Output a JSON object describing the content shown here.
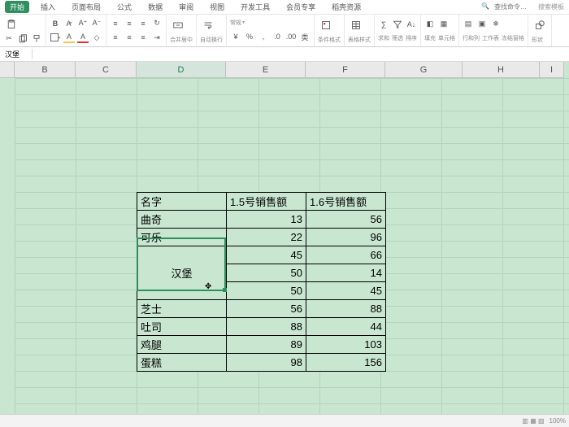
{
  "menus": {
    "items": [
      "开始",
      "插入",
      "页面布局",
      "公式",
      "数据",
      "审阅",
      "视图",
      "开发工具",
      "会员专享",
      "稻壳资源"
    ],
    "active": 0,
    "search_placeholder": "查找命令…",
    "search_hint": "搜索模板"
  },
  "ribbon": {
    "paste": "粘贴",
    "align_label": "合并居中",
    "wrap_label": "自动换行",
    "general": "常规",
    "cond_fmt": "条件格式",
    "table_style": "表格样式",
    "sum": "求和",
    "filter": "筛选",
    "sort": "排序",
    "fill": "填充",
    "cell": "单元格",
    "row_col": "行和列",
    "worksheet": "工作表",
    "freeze": "冻结窗格",
    "shapes": "形状"
  },
  "namebox": "汉堡",
  "columns": [
    "B",
    "C",
    "D",
    "E",
    "F",
    "G",
    "H",
    "I"
  ],
  "table": {
    "headers": [
      "名字",
      "1.5号销售额",
      "1.6号销售额"
    ],
    "rows": [
      {
        "name": "曲奇",
        "v1": 13,
        "v2": 56
      },
      {
        "name": "可乐",
        "v1": 22,
        "v2": 96
      },
      {
        "name": "汉堡",
        "span": 3,
        "cells": [
          [
            45,
            66
          ],
          [
            50,
            14
          ],
          [
            50,
            45
          ]
        ]
      },
      {
        "name": "芝士",
        "v1": 56,
        "v2": 88
      },
      {
        "name": "吐司",
        "v1": 88,
        "v2": 44
      },
      {
        "name": "鸡腿",
        "v1": 89,
        "v2": 103
      },
      {
        "name": "蛋糕",
        "v1": 98,
        "v2": 156
      }
    ]
  },
  "status": {
    "left": "",
    "zoom": "100%",
    "views": "页面"
  }
}
